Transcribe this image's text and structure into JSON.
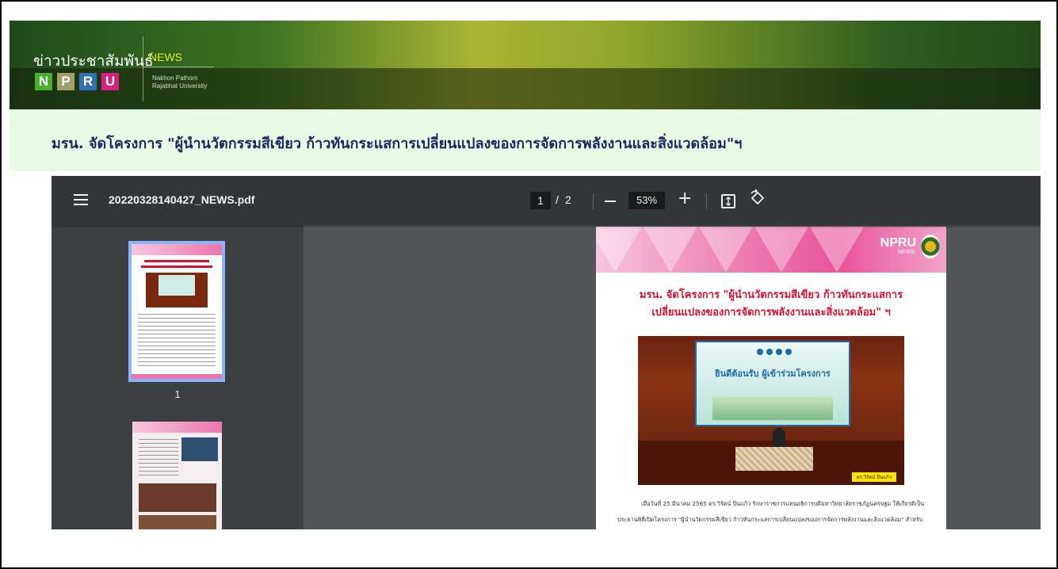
{
  "banner": {
    "brand_thai": "ข่าวประชาสัมพันธ์",
    "brand_news": "NEWS",
    "letters": [
      "N",
      "P",
      "R",
      "U"
    ],
    "university_name": "Nakhon Pathom\nRajabhat University"
  },
  "headline": "มรน. จัดโครงการ \"ผู้นำนวัตกรรมสีเขียว ก้าวทันกระแสการเปลี่ยนแปลงของการจัดการพลังงานและสิ่งแวดล้อม\"ฯ",
  "pdf_viewer": {
    "filename": "20220328140427_NEWS.pdf",
    "current_page": "1",
    "page_separator": "/",
    "total_pages": "2",
    "zoom": "53%",
    "thumbnails": [
      {
        "label": "1",
        "selected": true
      },
      {
        "label": "",
        "selected": false
      }
    ],
    "icons": [
      "menu-icon",
      "zoom-out-icon",
      "zoom-in-icon",
      "fit-page-icon",
      "rotate-icon"
    ]
  },
  "document": {
    "logo_text": "NPRU",
    "logo_sub": "NEWS",
    "title_line1": "มรน. จัดโครงการ \"ผู้นำนวัตกรรมสีเขียว ก้าวทันกระแสการ",
    "title_line2": "เปลี่ยนแปลงของการจัดการพลังงานและสิ่งแวดล้อม\" ฯ",
    "photo_screen_title": "ยินดีต้อนรับ ผู้เข้าร่วมโครงการ",
    "photo_caption": "ดร.วิรัตน์ ปิ่นแก้ว",
    "body": "เมื่อวันที่ 25 มีนาคม 2565 ดร.วิรัตน์ ปิ่นแก้ว รักษาราชการแทนอธิการบดีมหาวิทยาลัยราชภัฏนครปฐม ให้เกียรติเป็นประธานพิธีเปิดโครงการ \"ผู้นำนวัตกรรมสีเขียว ก้าวทันกระแสการเปลี่ยนแปลงของการจัดการพลังงานและสิ่งแวดล้อม\" สำหรับเครือข่ายการประกันคุณภาพการศึกษา สำนักวิทยบริการและ"
  },
  "colors": {
    "headline_text": "#1a2a60",
    "headline_bg": "#e8fbe4",
    "viewer_bg": "#525659",
    "toolbar_bg": "#323639",
    "doc_title": "#d8112c",
    "thumbnail_selected_border": "#8ab4f8"
  }
}
